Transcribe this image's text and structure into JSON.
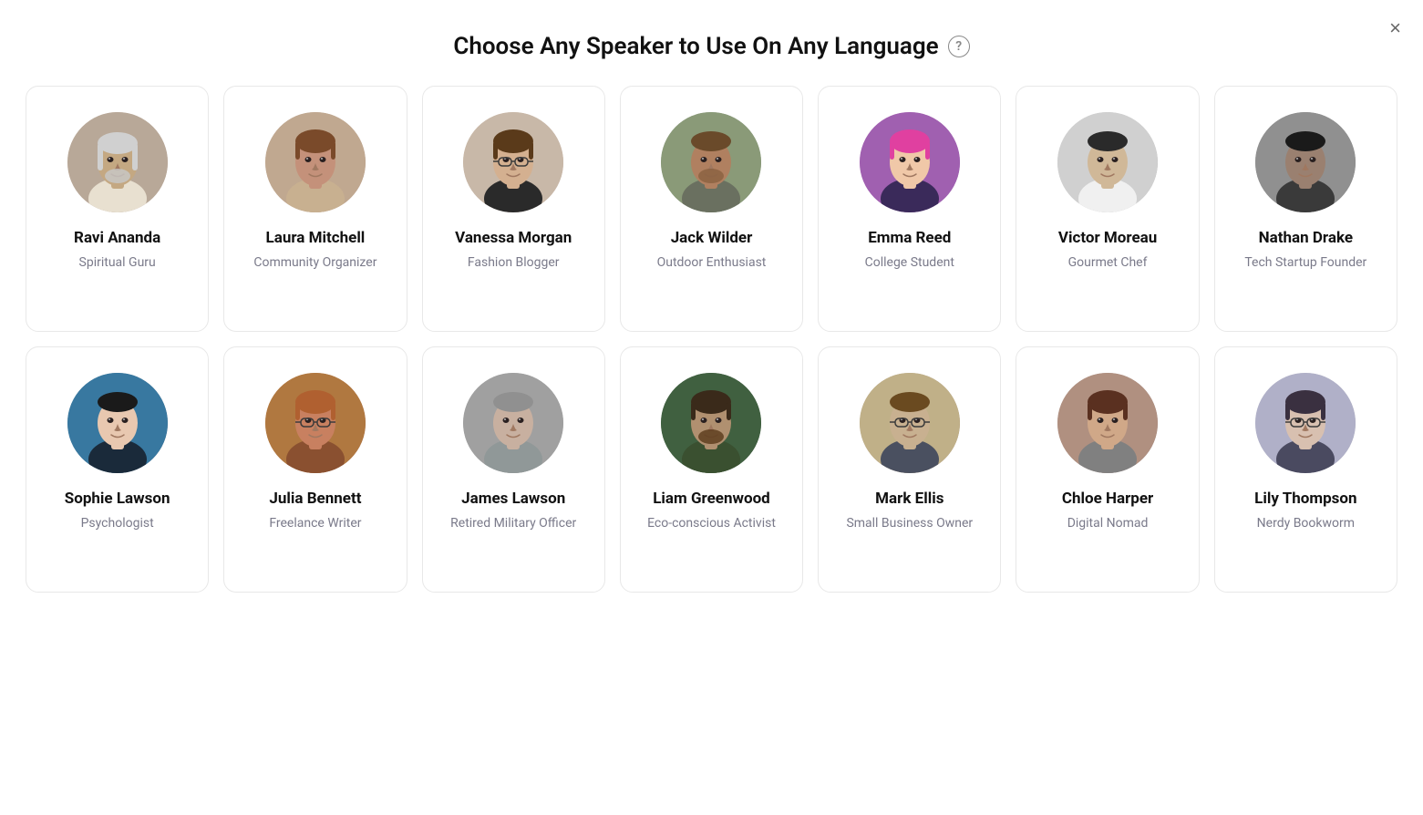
{
  "page": {
    "title": "Choose Any Speaker to Use On Any Language",
    "close_label": "×",
    "help_icon": "?"
  },
  "speakers": [
    {
      "id": "ravi",
      "name": "Ravi Ananda",
      "role": "Spiritual Guru",
      "avatar_class": "avatar-ravi",
      "emoji": "🧔"
    },
    {
      "id": "laura",
      "name": "Laura Mitchell",
      "role": "Community Organizer",
      "avatar_class": "avatar-laura",
      "emoji": "👩"
    },
    {
      "id": "vanessa",
      "name": "Vanessa Morgan",
      "role": "Fashion Blogger",
      "avatar_class": "avatar-vanessa",
      "emoji": "👓"
    },
    {
      "id": "jack",
      "name": "Jack Wilder",
      "role": "Outdoor Enthusiast",
      "avatar_class": "avatar-jack",
      "emoji": "🧔"
    },
    {
      "id": "emma",
      "name": "Emma Reed",
      "role": "College Student",
      "avatar_class": "avatar-emma",
      "emoji": "👩"
    },
    {
      "id": "victor",
      "name": "Victor Moreau",
      "role": "Gourmet Chef",
      "avatar_class": "avatar-victor",
      "emoji": "👨"
    },
    {
      "id": "nathan",
      "name": "Nathan Drake",
      "role": "Tech Startup Founder",
      "avatar_class": "avatar-nathan",
      "emoji": "🧑"
    },
    {
      "id": "sophie",
      "name": "Sophie Lawson",
      "role": "Psychologist",
      "avatar_class": "avatar-sophie",
      "emoji": "👩"
    },
    {
      "id": "julia",
      "name": "Julia Bennett",
      "role": "Freelance Writer",
      "avatar_class": "avatar-julia",
      "emoji": "👩"
    },
    {
      "id": "james",
      "name": "James Lawson",
      "role": "Retired Military Officer",
      "avatar_class": "avatar-james",
      "emoji": "👨"
    },
    {
      "id": "liam",
      "name": "Liam Greenwood",
      "role": "Eco-conscious Activist",
      "avatar_class": "avatar-liam",
      "emoji": "🧔"
    },
    {
      "id": "mark",
      "name": "Mark Ellis",
      "role": "Small Business Owner",
      "avatar_class": "avatar-mark",
      "emoji": "👨"
    },
    {
      "id": "chloe",
      "name": "Chloe Harper",
      "role": "Digital Nomad",
      "avatar_class": "avatar-chloe",
      "emoji": "👩"
    },
    {
      "id": "lily",
      "name": "Lily Thompson",
      "role": "Nerdy Bookworm",
      "avatar_class": "avatar-lily",
      "emoji": "👓"
    }
  ]
}
